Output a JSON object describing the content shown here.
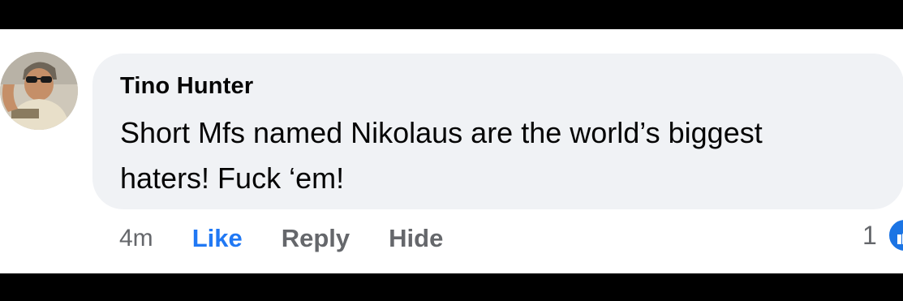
{
  "comment": {
    "author": "Tino Hunter",
    "text": "Short Mfs named Nikolaus are the world’s biggest\nhaters! Fuck ‘em!",
    "timestamp": "4m",
    "reaction_count": "1"
  },
  "actions": {
    "like_label": "Like",
    "reply_label": "Reply",
    "hide_label": "Hide"
  },
  "icons": {
    "avatar": "profile-photo",
    "reaction": "like-reaction-icon"
  },
  "colors": {
    "bubble": "#f0f2f5",
    "link_active": "#2078f4",
    "secondary_text": "#65676b",
    "reaction_blue": "#1b74e4"
  }
}
